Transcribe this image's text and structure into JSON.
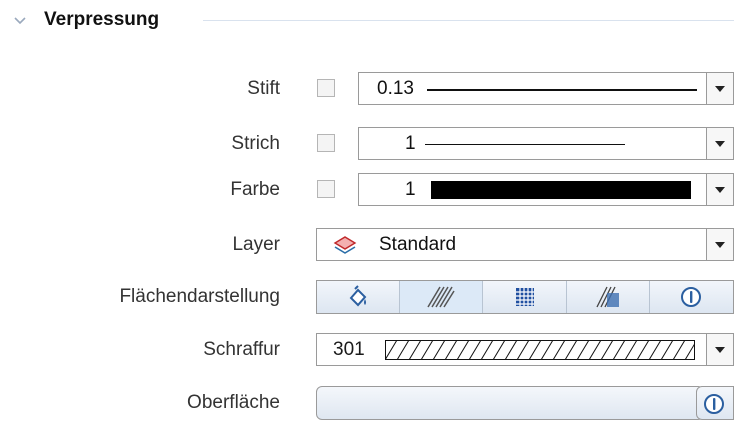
{
  "section": {
    "title": "Verpressung"
  },
  "rows": {
    "stift": {
      "label": "Stift",
      "value": "0.13"
    },
    "strich": {
      "label": "Strich",
      "value": "1"
    },
    "farbe": {
      "label": "Farbe",
      "value": "1",
      "swatch_color": "#000000"
    },
    "layer": {
      "label": "Layer",
      "value": "Standard"
    },
    "flaechen": {
      "label": "Flächendarstellung",
      "options": [
        "fill-bucket-icon",
        "hatch-icon",
        "pattern-grid-icon",
        "gradient-icon",
        "info-circle-icon"
      ],
      "selected": "hatch-icon"
    },
    "schraffur": {
      "label": "Schraffur",
      "value": "301"
    },
    "oberflaeche": {
      "label": "Oberfläche"
    }
  },
  "colors": {
    "accent_selected": "#dce9f7",
    "border": "#9a9a9a",
    "divider": "#d9e2ee"
  }
}
